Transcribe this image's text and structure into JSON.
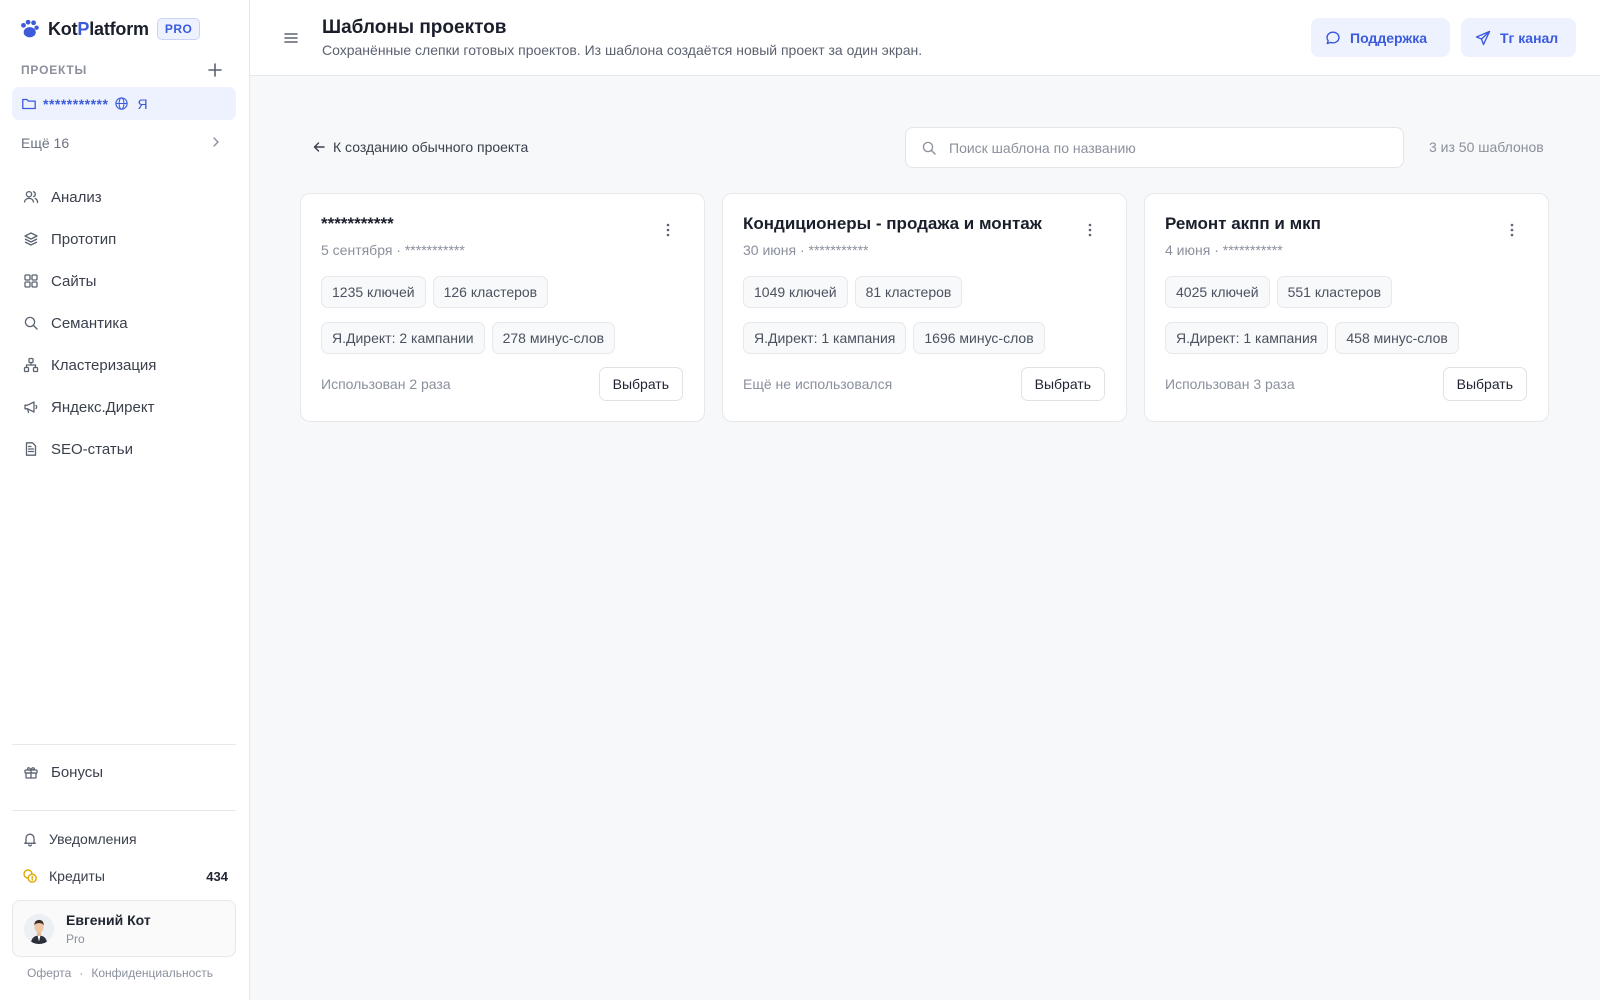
{
  "brand": {
    "name_pre": "Kot",
    "name_accent": "P",
    "name_post": "latform",
    "badge": "PRO"
  },
  "sidebar": {
    "section_label": "ПРОЕКТЫ",
    "active_project": {
      "name": "***********",
      "flag": "Я"
    },
    "more_label": "Ещё 16",
    "nav": [
      {
        "label": "Анализ",
        "icon": "users-icon"
      },
      {
        "label": "Прототип",
        "icon": "layers-icon"
      },
      {
        "label": "Сайты",
        "icon": "grid-icon"
      },
      {
        "label": "Семантика",
        "icon": "search-icon"
      },
      {
        "label": "Кластеризация",
        "icon": "cluster-icon"
      },
      {
        "label": "Яндекс.Директ",
        "icon": "megaphone-icon"
      },
      {
        "label": "SEO-статьи",
        "icon": "document-icon"
      }
    ],
    "bonus_label": "Бонусы",
    "notifications_label": "Уведомления",
    "credits_label": "Кредиты",
    "credits_value": "434",
    "user": {
      "name": "Евгений Кот",
      "plan": "Pro"
    },
    "legal": {
      "offer": "Оферта",
      "separator": "·",
      "privacy": "Конфиденциальность"
    }
  },
  "header": {
    "title": "Шаблоны проектов",
    "subtitle": "Сохранённые слепки готовых проектов. Из шаблона создаётся новый проект за один экран.",
    "support_label": "Поддержка",
    "tg_label": "Тг канал"
  },
  "main": {
    "back_label": "К созданию обычного проекта",
    "search_placeholder": "Поиск шаблона по названию",
    "count_text": "3 из 50 шаблонов",
    "cards": [
      {
        "title": "***********",
        "meta": "5 сентября · ***********",
        "chips": [
          "1235 ключей",
          "126 кластеров",
          "Я.Директ: 2 кампании",
          "278 минус-слов"
        ],
        "usage": "Использован 2 раза",
        "button": "Выбрать"
      },
      {
        "title": "Кондиционеры - продажа и монтаж",
        "meta": "30 июня · ***********",
        "chips": [
          "1049 ключей",
          "81 кластеров",
          "Я.Директ: 1 кампания",
          "1696 минус-слов"
        ],
        "usage": "Ещё не использовался",
        "button": "Выбрать"
      },
      {
        "title": "Ремонт акпп и мкп",
        "meta": "4 июня · ***********",
        "chips": [
          "4025 ключей",
          "551 кластеров",
          "Я.Директ: 1 кампания",
          "458 минус-слов"
        ],
        "usage": "Использован 3 раза",
        "button": "Выбрать"
      }
    ]
  },
  "colors": {
    "accent": "#3b5bdb",
    "accent_bg": "#eef2ff",
    "credits_icon": "#e0a800"
  }
}
